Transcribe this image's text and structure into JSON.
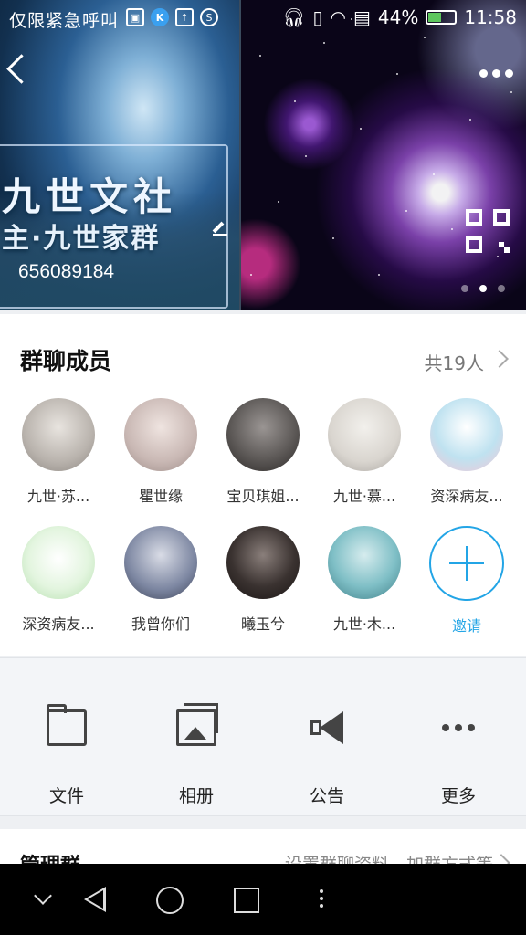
{
  "status_bar": {
    "left_text": "仅限紧急呼叫",
    "battery": "44%",
    "battery_level": 0.44,
    "time": "11:58",
    "icons": [
      "gallery-icon",
      "k-app-icon",
      "upload-icon",
      "headset-icon",
      "headphones-icon",
      "vibrate-icon",
      "wifi-icon",
      "sim-icon",
      "battery-icon"
    ]
  },
  "header": {
    "group_name": "九世文社",
    "group_subtitle": "主·九世家群",
    "group_id": "656089184",
    "icons": [
      "back-icon",
      "more-dots-icon",
      "edit-icon",
      "qr-code-icon"
    ],
    "carousel_pages": 3,
    "carousel_active": 2
  },
  "members": {
    "title": "群聊成员",
    "count": "共19人",
    "list": [
      {
        "name": "九世·苏...",
        "color": "#b9b3ad"
      },
      {
        "name": "瞿世缘",
        "color": "#c9b8b4"
      },
      {
        "name": "宝贝琪姐...",
        "color": "#5e5a58"
      },
      {
        "name": "九世·慕...",
        "color": "#d9d5cf"
      },
      {
        "name": "资深病友...",
        "color": "#bfe2f0"
      },
      {
        "name": "深资病友...",
        "color": "#e3f5df"
      },
      {
        "name": "我曾你们",
        "color": "#7c86a1"
      },
      {
        "name": "曦玉兮",
        "color": "#3a3230"
      },
      {
        "name": "九世·木...",
        "color": "#7fbfc6"
      }
    ],
    "invite_label": "邀请"
  },
  "actions": [
    {
      "label": "文件",
      "icon": "folder-icon"
    },
    {
      "label": "相册",
      "icon": "album-icon"
    },
    {
      "label": "公告",
      "icon": "announcement-icon"
    },
    {
      "label": "更多",
      "icon": "more-icon"
    }
  ],
  "manage": {
    "title": "管理群",
    "value": "设置群聊资料、加群方式等"
  },
  "colors": {
    "accent": "#23a5e6",
    "background": "#eef0f3"
  }
}
